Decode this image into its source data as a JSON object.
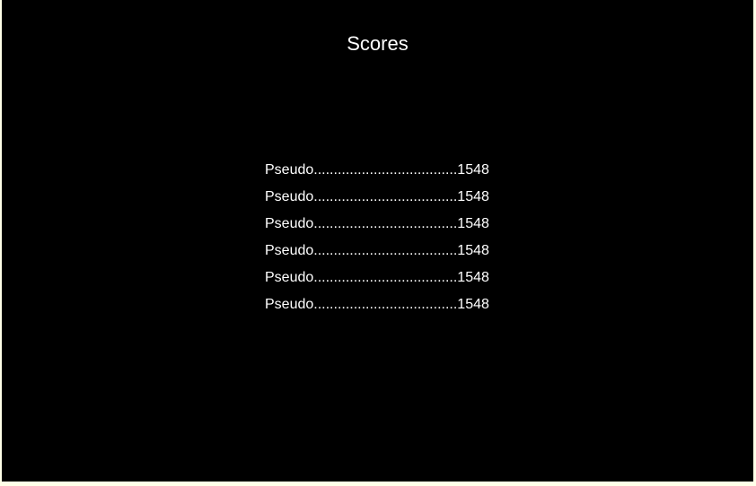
{
  "screen": {
    "title": "Scores"
  },
  "scores": [
    {
      "name": "Pseudo",
      "dots": "....................................",
      "score": "1548"
    },
    {
      "name": "Pseudo",
      "dots": "....................................",
      "score": "1548"
    },
    {
      "name": "Pseudo",
      "dots": "....................................",
      "score": "1548"
    },
    {
      "name": "Pseudo",
      "dots": "....................................",
      "score": "1548"
    },
    {
      "name": "Pseudo",
      "dots": "....................................",
      "score": "1548"
    },
    {
      "name": "Pseudo",
      "dots": "....................................",
      "score": "1548"
    }
  ],
  "colors": {
    "background": "#000000",
    "text": "#ffffff"
  }
}
